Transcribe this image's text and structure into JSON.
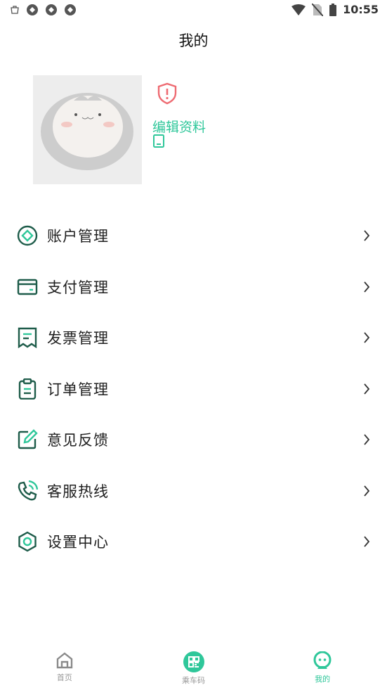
{
  "status_bar": {
    "time": "10:55"
  },
  "header": {
    "title": "我的"
  },
  "profile": {
    "edit_label": "编辑资料"
  },
  "menu": {
    "items": [
      {
        "label": "账户管理",
        "icon": "account-icon"
      },
      {
        "label": "支付管理",
        "icon": "wallet-icon"
      },
      {
        "label": "发票管理",
        "icon": "invoice-icon"
      },
      {
        "label": "订单管理",
        "icon": "order-clipboard-icon"
      },
      {
        "label": "意见反馈",
        "icon": "feedback-edit-icon"
      },
      {
        "label": "客服热线",
        "icon": "phone-call-icon"
      },
      {
        "label": "设置中心",
        "icon": "settings-icon"
      }
    ]
  },
  "bottom_nav": {
    "items": [
      {
        "label": "首页",
        "icon": "home-icon"
      },
      {
        "label": "乘车码",
        "icon": "qr-code-icon"
      },
      {
        "label": "我的",
        "icon": "mine-icon",
        "active": true
      }
    ]
  },
  "colors": {
    "accent": "#2fc79a",
    "icon_dark": "#1e5c4a",
    "warning": "#ee6b72"
  }
}
